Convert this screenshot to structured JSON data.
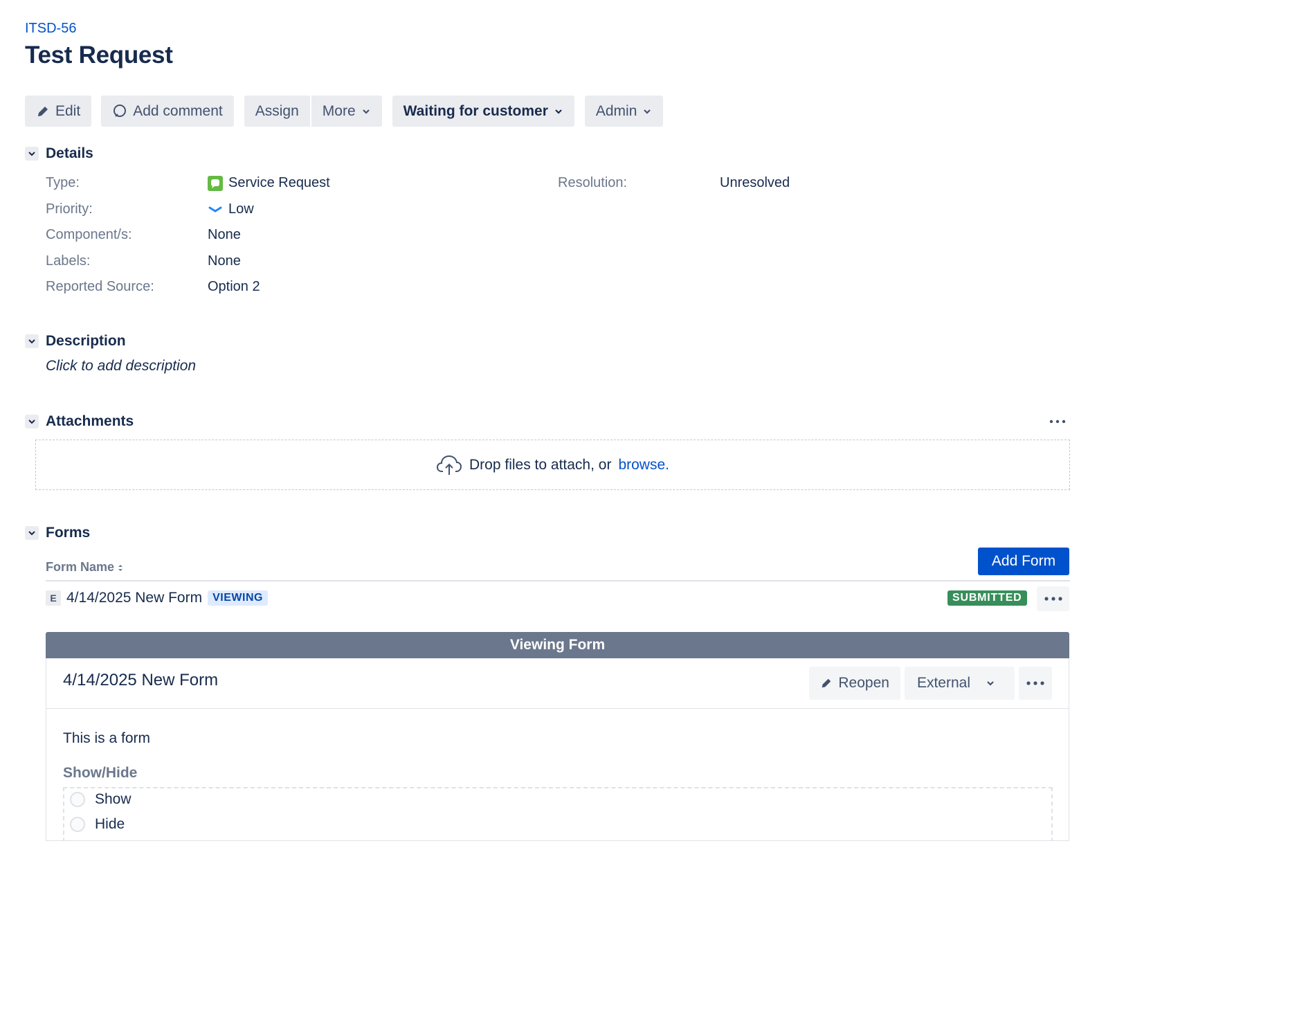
{
  "issue": {
    "key": "ITSD-56",
    "title": "Test Request"
  },
  "toolbar": {
    "edit": "Edit",
    "add_comment": "Add comment",
    "assign": "Assign",
    "more": "More",
    "status": "Waiting for customer",
    "admin": "Admin"
  },
  "details": {
    "heading": "Details",
    "type_label": "Type:",
    "type_value": "Service Request",
    "priority_label": "Priority:",
    "priority_value": "Low",
    "components_label": "Component/s:",
    "components_value": "None",
    "labels_label": "Labels:",
    "labels_value": "None",
    "source_label": "Reported Source:",
    "source_value": "Option 2",
    "resolution_label": "Resolution:",
    "resolution_value": "Unresolved"
  },
  "description": {
    "heading": "Description",
    "placeholder": "Click to add description"
  },
  "attachments": {
    "heading": "Attachments",
    "drop_text": "Drop files to attach, or",
    "browse_link": "browse."
  },
  "forms": {
    "heading": "Forms",
    "column_header": "Form Name",
    "add_button": "Add Form",
    "row": {
      "badge": "E",
      "name": "4/14/2025 New Form",
      "viewing": "VIEWING",
      "status": "SUBMITTED"
    },
    "viewer": {
      "banner": "Viewing Form",
      "title": "4/14/2025 New Form",
      "reopen": "Reopen",
      "visibility": "External",
      "body_text": "This is a form",
      "question_label": "Show/Hide",
      "options": [
        "Show",
        "Hide"
      ]
    }
  },
  "colors": {
    "link": "#0052cc",
    "primary_button": "#0052cc",
    "submitted": "#388e5a",
    "viewing_bar": "#6b778c",
    "service_request_icon": "#65ba43"
  }
}
